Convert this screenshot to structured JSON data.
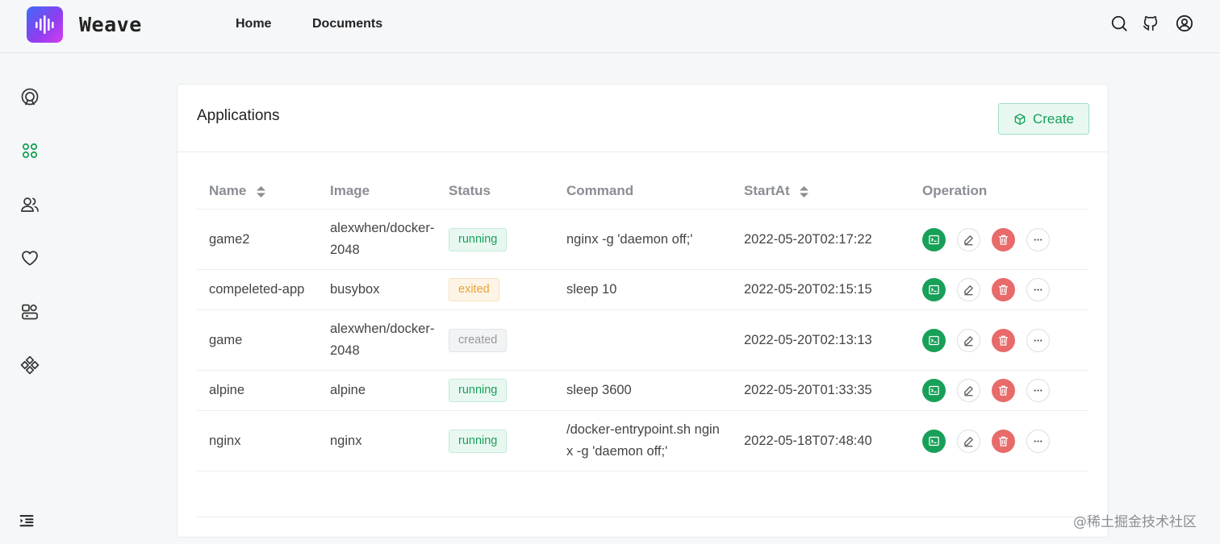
{
  "header": {
    "brand": "Weave",
    "nav": [
      {
        "label": "Home"
      },
      {
        "label": "Documents"
      }
    ],
    "icons": [
      "search-icon",
      "github-icon",
      "user-icon"
    ]
  },
  "sidebar": {
    "icons": [
      "dashboard-icon",
      "apps-icon",
      "users-icon",
      "heart-icon",
      "server-icon",
      "components-icon"
    ],
    "collapse_icon": "indent-icon",
    "active_index": 1,
    "active_color": "#18a058"
  },
  "card": {
    "title": "Applications",
    "create_label": "Create"
  },
  "table": {
    "columns": {
      "name": "Name",
      "image": "Image",
      "status": "Status",
      "command": "Command",
      "start": "StartAt",
      "operation": "Operation"
    },
    "rows": [
      {
        "name": "game2",
        "image": "alexwhen/docker-2048",
        "status": "running",
        "command": "nginx -g 'daemon off;'",
        "start": "2022-05-20T02:17:22"
      },
      {
        "name": "compeleted-app",
        "image": "busybox",
        "status": "exited",
        "command": "sleep 10",
        "start": "2022-05-20T02:15:15"
      },
      {
        "name": "game",
        "image": "alexwhen/docker-2048",
        "status": "created",
        "command": "",
        "start": "2022-05-20T02:13:13"
      },
      {
        "name": "alpine",
        "image": "alpine",
        "status": "running",
        "command": "sleep 3600",
        "start": "2022-05-20T01:33:35"
      },
      {
        "name": "nginx",
        "image": "nginx",
        "status": "running",
        "command": "/docker-entrypoint.sh nginx -g 'daemon off;'",
        "start": "2022-05-18T07:48:40"
      }
    ]
  },
  "colors": {
    "running": "#18a058",
    "exited": "#e6a23c",
    "created": "#999999",
    "delete": "#e86a6a"
  },
  "watermark": "@稀土掘金技术社区"
}
